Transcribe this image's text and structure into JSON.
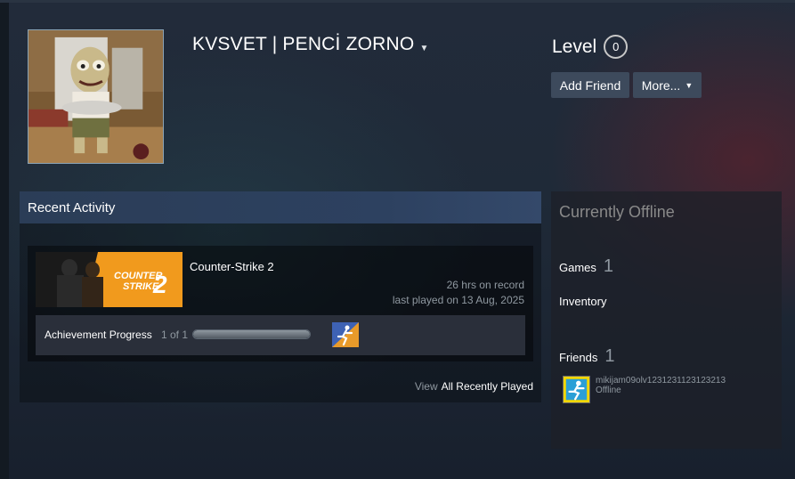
{
  "profile": {
    "persona_name": "KVSVET | PENCİ ZORNO",
    "level_label": "Level",
    "level_value": "0"
  },
  "actions": {
    "add_friend": "Add Friend",
    "more": "More..."
  },
  "recent_activity": {
    "header": "Recent Activity",
    "game": {
      "name": "Counter-Strike 2",
      "hours": "26 hrs on record",
      "last_played": "last played on 13 Aug, 2025",
      "capsule_text_line1": "COUNTER",
      "capsule_text_line2": "STRIKE",
      "capsule_number": "2"
    },
    "achievement": {
      "label": "Achievement Progress",
      "count": "1 of 1",
      "progress": 1.0
    },
    "view_label": "View",
    "view_all": "All Recently Played"
  },
  "status": {
    "title": "Currently Offline",
    "games_label": "Games",
    "games_count": "1",
    "inventory_label": "Inventory",
    "friends_label": "Friends",
    "friends_count": "1",
    "friend": {
      "name": "mikijam09olv1231231123123213",
      "state": "Offline"
    }
  },
  "colors": {
    "accent_capsule": "#f19a1d",
    "header_blue": "#2d4160",
    "friend_avatar": "#f2d600"
  }
}
